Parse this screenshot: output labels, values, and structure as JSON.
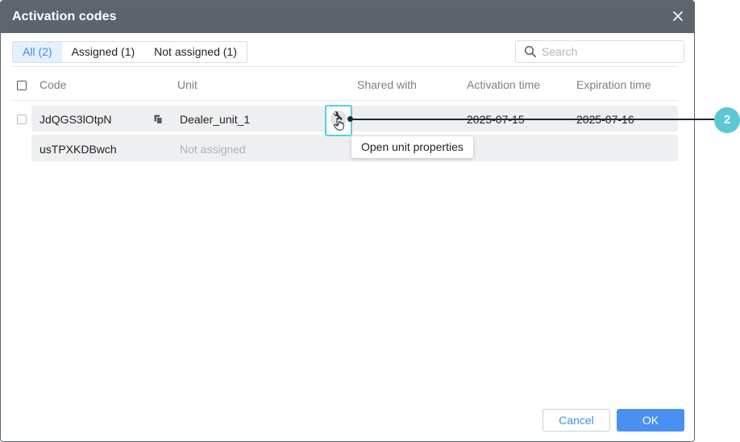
{
  "dialog": {
    "title": "Activation codes",
    "close_icon": "close-icon"
  },
  "tabs": [
    {
      "label": "All (2)",
      "active": true
    },
    {
      "label": "Assigned (1)",
      "active": false
    },
    {
      "label": "Not assigned (1)",
      "active": false
    }
  ],
  "search": {
    "placeholder": "Search",
    "value": "",
    "icon": "search-icon"
  },
  "table": {
    "columns": [
      "Code",
      "Unit",
      "Shared with",
      "Activation time",
      "Expiration time"
    ],
    "rows": [
      {
        "code": "JdQGS3lOtpN",
        "unit": "Dealer_unit_1",
        "shared_with": "",
        "activation_time": "2025-07-15",
        "expiration_time": "2025-07-16"
      },
      {
        "code": "usTPXKDBwch",
        "unit": "Not assigned",
        "shared_with": "",
        "activation_time": "",
        "expiration_time": ""
      }
    ]
  },
  "tooltip": {
    "text": "Open unit properties"
  },
  "callout": {
    "number": "2",
    "color": "#5bc8d4"
  },
  "footer": {
    "cancel_label": "Cancel",
    "ok_label": "OK"
  },
  "colors": {
    "titlebar": "#5d646e",
    "accent": "#4a90f0",
    "active_tab_bg": "#e4efff",
    "highlight": "#56d0de"
  }
}
